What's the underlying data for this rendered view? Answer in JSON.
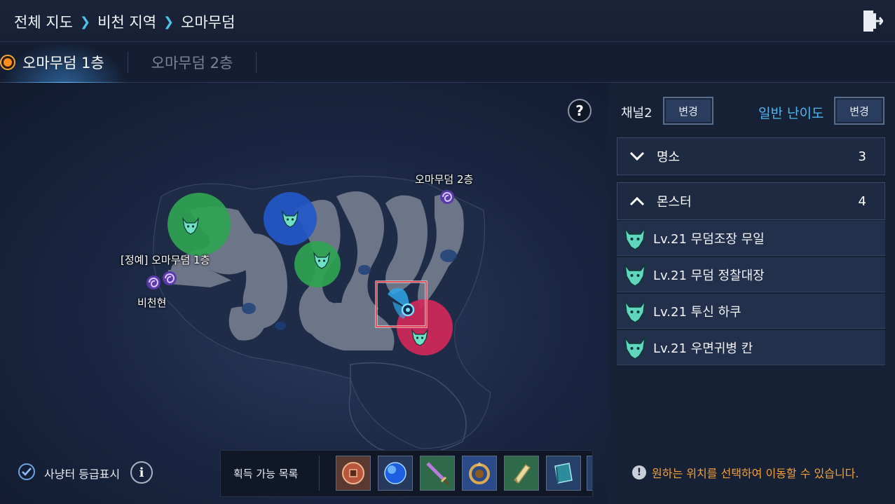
{
  "breadcrumb": {
    "items": [
      "전체 지도",
      "비천 지역",
      "오마무덤"
    ],
    "exit_icon": "exit-door-icon"
  },
  "tabs": [
    {
      "label": "오마무덤 1층",
      "active": true
    },
    {
      "label": "오마무덤 2층",
      "active": false
    }
  ],
  "map": {
    "help_label": "?",
    "labels": {
      "floor2_portal": "오마무덤 2층",
      "elite_floor1": "[정예] 오마무덤 1층",
      "bicheon": "비천현"
    },
    "zone_colors": {
      "green": "#2fa352",
      "blue": "#2458c9",
      "red": "#d1285a"
    },
    "player_marker_icon": "player-location-icon"
  },
  "panel": {
    "channel": "채널2",
    "channel_change": "변경",
    "difficulty": "일반 난이도",
    "difficulty_change": "변경",
    "sections": [
      {
        "label": "명소",
        "count": "3",
        "expanded": false
      },
      {
        "label": "몬스터",
        "count": "4",
        "expanded": true
      }
    ],
    "monsters": [
      "Lv.21 무덤조장 무일",
      "Lv.21 무덤 정찰대장",
      "Lv.21 투신 하쿠",
      "Lv.21 우면귀병 칸"
    ]
  },
  "footer": {
    "grade_display": "사냥터 등급표시",
    "grade_checked": true,
    "info_label": "i",
    "loot_label": "획득 가능 목록",
    "loot_items": [
      "coin-icon",
      "blue-orb-icon",
      "sword-icon",
      "dragon-amulet-icon",
      "scroll-icon",
      "book-icon"
    ],
    "notice_icon": "!",
    "notice": "원하는 위치를 선택하여 이동할 수 있습니다."
  }
}
